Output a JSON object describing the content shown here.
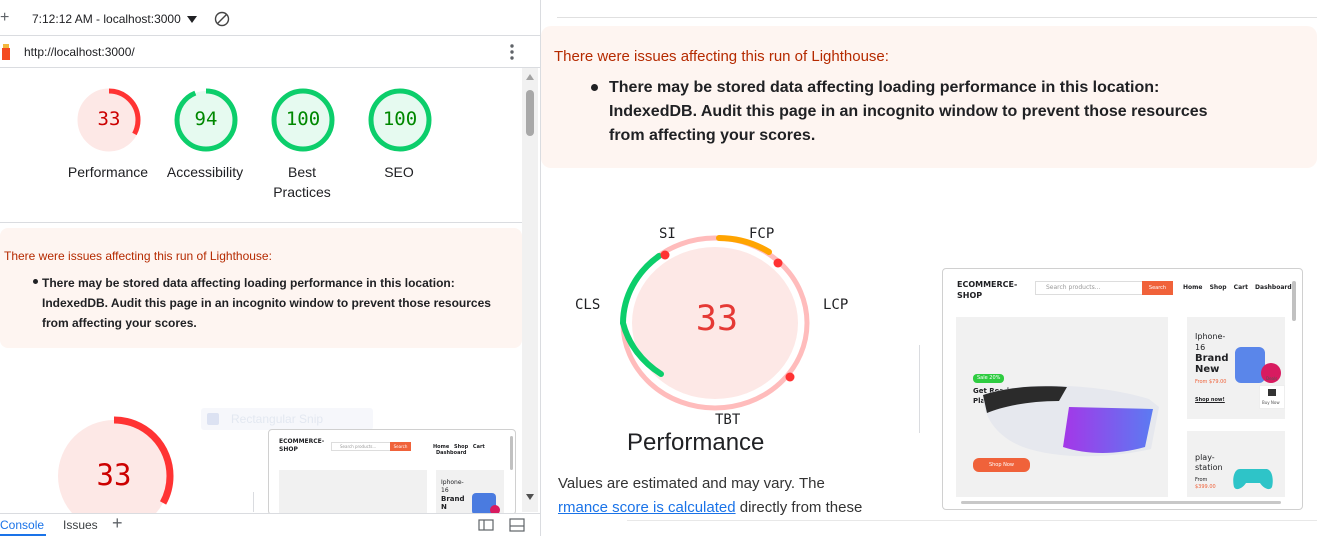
{
  "topbar": {
    "time_host": "7:12:12 AM - localhost:3000"
  },
  "urlbar": {
    "url": "http://localhost:3000/"
  },
  "scores": [
    {
      "label": "Performance",
      "value": "33",
      "color": "#ff3333"
    },
    {
      "label": "Accessibility",
      "value": "94",
      "color": "#0cce6b"
    },
    {
      "label": "Best Practices",
      "value": "100",
      "color": "#0cce6b"
    },
    {
      "label": "SEO",
      "value": "100",
      "color": "#0cce6b"
    }
  ],
  "score_labels": {
    "best_line1": "Best",
    "best_line2": "Practices"
  },
  "warning": {
    "title": "There were issues affecting this run of Lighthouse:",
    "line1": "There may be stored data affecting loading performance in this location:",
    "line2": "IndexedDB. Audit this page in an incognito window to prevent those resources",
    "line3": "from affecting your scores."
  },
  "left_bottom": {
    "perf_value": "33",
    "tooltip": "Rectangular Snip"
  },
  "bottombar": {
    "console": "Console",
    "issues": "Issues"
  },
  "perf_gauge": {
    "value": "33",
    "title": "Performance",
    "metrics": {
      "si": "SI",
      "fcp": "FCP",
      "lcp": "LCP",
      "tbt": "TBT",
      "cls": "CLS"
    }
  },
  "estimate": {
    "line1": "Values are estimated and may vary. The",
    "link": "rmance score is calculated",
    "line2_rest": " directly from these"
  },
  "screenshot": {
    "logo1": "ECOMMERCE-",
    "logo2": "SHOP",
    "search_placeholder": "Search products...",
    "search_btn": "Search",
    "nav": [
      "Home",
      "Shop",
      "Cart",
      "Dashboard"
    ],
    "sale_badge": "Sale 20%",
    "hero1": "Get Ready For",
    "hero2": "PlayStation",
    "shop_now": "Shop Now",
    "card1_l1": "Iphone-",
    "card1_l2": "16",
    "card1_l3": "Brand",
    "card1_l4": "New",
    "card1_price": "From $79.00",
    "card1_shop": "Shop now!",
    "card2_l1": "play-",
    "card2_l2": "station",
    "card2_price": "From",
    "card2_price2": "$399.00",
    "side1": "Deals",
    "side2": "Buy Now"
  },
  "left_shot": {
    "logo1": "ECOMMERCE-",
    "logo2": "SHOP",
    "search_placeholder": "Search products...",
    "search_btn": "Search",
    "nav": [
      "Home",
      "Shop",
      "Cart",
      "Dashboard"
    ],
    "card1_l1": "Iphone-",
    "card1_l2": "16",
    "card1_l3": "Brand",
    "card1_l4": "N"
  }
}
